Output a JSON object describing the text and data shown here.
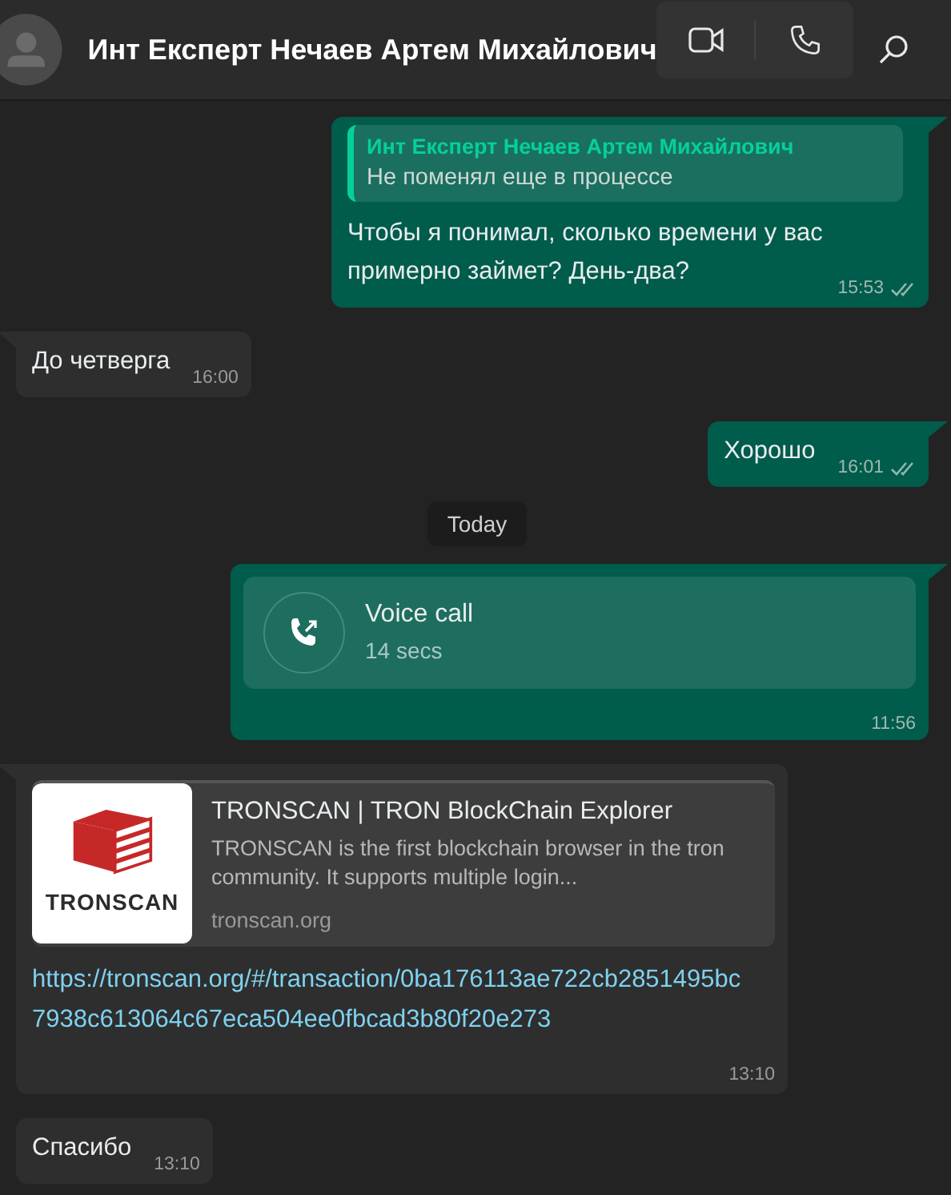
{
  "header": {
    "contact_name": "Инт Експерт Нечаев Артем Михайлович"
  },
  "messages": [
    {
      "kind": "text",
      "outgoing": true,
      "tail": true,
      "quote": {
        "author": "Инт Експерт Нечаев Артем Михайлович",
        "text": "Не поменял еще в процессе"
      },
      "text": "Чтобы я понимал, сколько времени у вас примерно займет? День-два?",
      "time": "15:53",
      "ticks": true
    },
    {
      "kind": "text",
      "outgoing": false,
      "tail": true,
      "text": "До четверга",
      "time": "16:00",
      "ticks": false
    },
    {
      "kind": "text",
      "outgoing": true,
      "tail": true,
      "text": "Хорошо",
      "time": "16:01",
      "ticks": true
    },
    {
      "kind": "date",
      "text": "Today"
    },
    {
      "kind": "call",
      "outgoing": true,
      "tail": true,
      "title": "Voice call",
      "duration": "14 secs",
      "time": "11:56",
      "ticks": false
    },
    {
      "kind": "link",
      "outgoing": false,
      "tail": true,
      "preview": {
        "logo_text": "TRONSCAN",
        "title": "TRONSCAN | TRON BlockChain Explorer",
        "description": "TRONSCAN is the first blockchain browser in the tron community. It supports multiple login...",
        "domain": "tronscan.org"
      },
      "url": "https://tronscan.org/#/transaction/0ba176113ae722cb2851495bc7938c613064c67eca504ee0fbcad3b80f20e273",
      "time": "13:10",
      "ticks": false
    },
    {
      "kind": "text",
      "outgoing": false,
      "tail": false,
      "text": "Спасибо",
      "time": "13:10",
      "ticks": false
    }
  ]
}
